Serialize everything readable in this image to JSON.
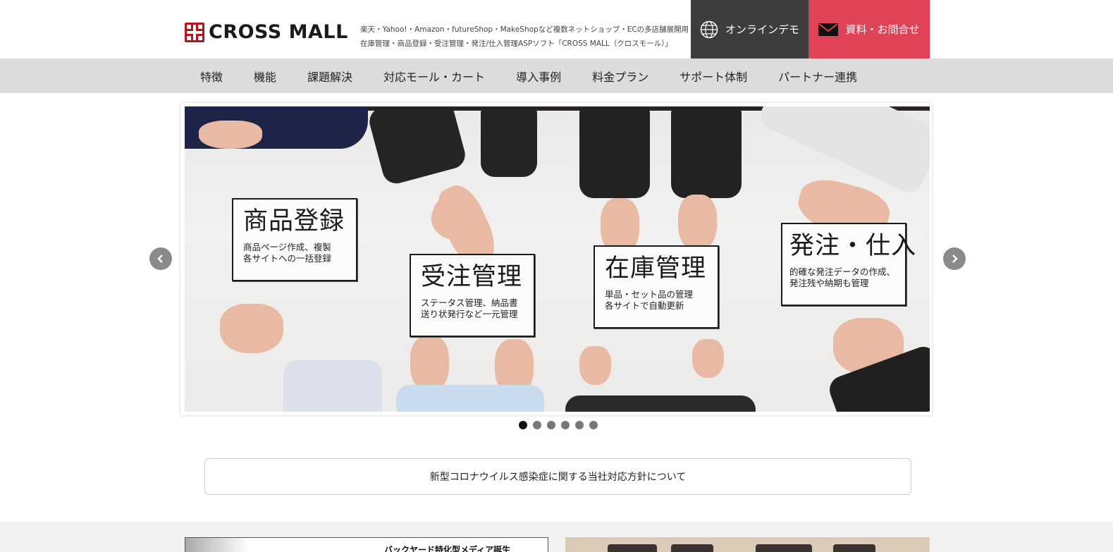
{
  "header": {
    "logo_text": "CROSS MALL",
    "tagline_line1": "楽天・Yahoo!・Amazon・futureShop・MakeShopなど複数ネットショップ・ECの多店舗展開用",
    "tagline_line2": "在庫管理・商品登録・受注管理・発注/仕入管理ASPソフト「CROSS MALL（クロスモール）」",
    "demo_label": "オンラインデモ",
    "contact_label": "資料・お問合せ"
  },
  "nav": {
    "items": [
      "特徴",
      "機能",
      "課題解決",
      "対応モール・カート",
      "導入事例",
      "料金プラン",
      "サポート体制",
      "パートナー連携"
    ]
  },
  "slider": {
    "cards": [
      {
        "title": "商品登録",
        "desc": "商品ページ作成、複製\n各サイトへの一括登録"
      },
      {
        "title": "受注管理",
        "desc": "ステータス管理、納品書\n送り状発行など一元管理"
      },
      {
        "title": "在庫管理",
        "desc": "単品・セット品の管理\n各サイトで自動更新"
      },
      {
        "title": "発注・仕入",
        "desc": "的確な発注データの作成、\n発注残や納期も管理"
      }
    ],
    "dot_count": 6,
    "active_dot": 0
  },
  "notice": {
    "text": "新型コロナウイルス感染症に関する当社対応方針について"
  },
  "bottom": {
    "banner_left_text": "バックヤード特化型メディア誕生"
  },
  "colors": {
    "demo_bg": "#3f3c3d",
    "contact_bg": "#e04256",
    "nav_bg": "#dcdcdc",
    "logo_red": "#b3151f"
  }
}
